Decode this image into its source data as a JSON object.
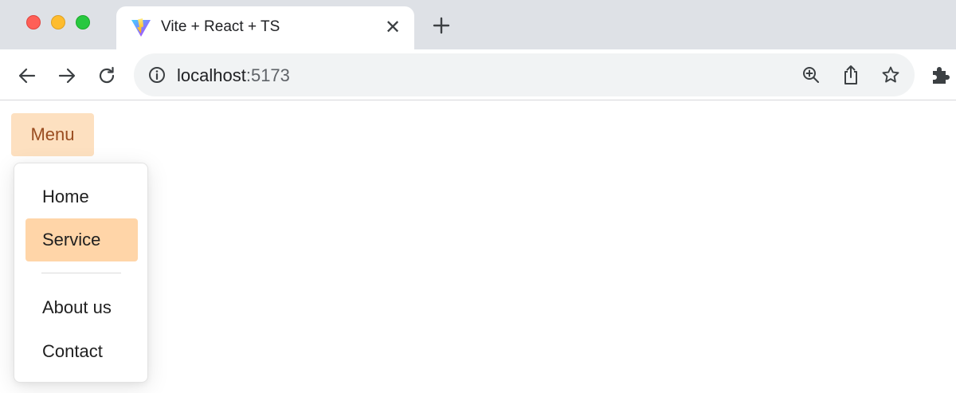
{
  "browser": {
    "tab": {
      "title": "Vite + React + TS",
      "favicon_icon": "vite-logo-icon",
      "close_label": "✕"
    },
    "new_tab_icon": "plus-icon",
    "address": {
      "host": "localhost",
      "port": ":5173"
    },
    "toolbar_icons": [
      "back-arrow-icon",
      "forward-arrow-icon",
      "reload-icon",
      "info-icon",
      "zoom-icon",
      "share-icon",
      "star-icon",
      "extensions-icon"
    ]
  },
  "page": {
    "menu_button_label": "Menu",
    "dropdown": {
      "items": [
        {
          "label": "Home",
          "active": false
        },
        {
          "label": "Service",
          "active": true
        },
        {
          "label": "About us",
          "active": false
        },
        {
          "label": "Contact",
          "active": false
        }
      ]
    }
  },
  "colors": {
    "menu_button_bg": "#fde0c0",
    "menu_button_text": "#9a4d20",
    "active_item_bg": "#ffd5a8",
    "tabstrip_bg": "#dee1e6"
  }
}
